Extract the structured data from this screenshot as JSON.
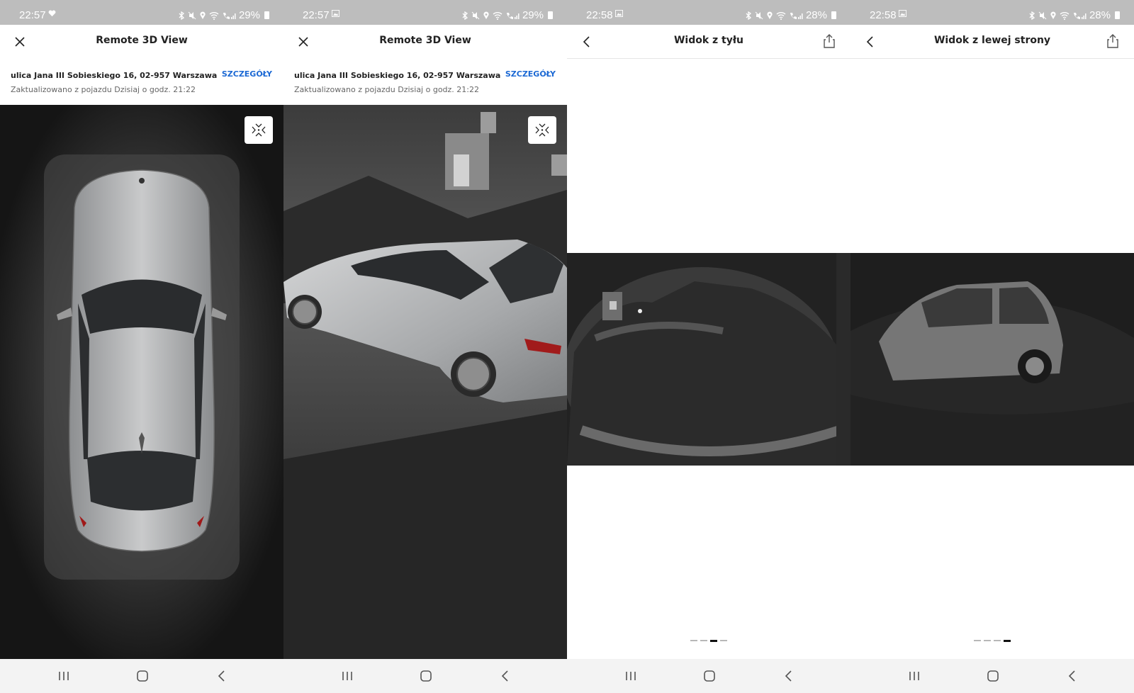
{
  "panels": [
    {
      "status": {
        "time": "22:57",
        "battery": "29%",
        "notif_icon": "heart-icon"
      },
      "header": {
        "title": "Remote 3D View",
        "left_icon": "close-icon"
      },
      "address": {
        "line1": "ulica Jana III Sobieskiego 16, 02-957 Warszawa",
        "line2": "Zaktualizowano z pojazdu Dzisiaj o godz. 21:22",
        "details": "SZCZEGÓŁY"
      }
    },
    {
      "status": {
        "time": "22:57",
        "battery": "29%",
        "notif_icon": "image-icon"
      },
      "header": {
        "title": "Remote 3D View",
        "left_icon": "close-icon"
      },
      "address": {
        "line1": "ulica Jana III Sobieskiego 16, 02-957 Warszawa",
        "line2": "Zaktualizowano z pojazdu Dzisiaj o godz. 21:22",
        "details": "SZCZEGÓŁY"
      }
    },
    {
      "status": {
        "time": "22:58",
        "battery": "28%",
        "notif_icon": "image-icon"
      },
      "header": {
        "title": "Widok z tyłu",
        "left_icon": "back-chevron-icon",
        "right_icon": "share-icon"
      },
      "pager": {
        "total": 4,
        "active_index": 2
      }
    },
    {
      "status": {
        "time": "22:58",
        "battery": "28%",
        "notif_icon": "image-icon"
      },
      "header": {
        "title": "Widok z lewej strony",
        "left_icon": "back-chevron-icon",
        "right_icon": "share-icon"
      },
      "pager": {
        "total": 4,
        "active_index": 3
      }
    }
  ],
  "status_icons": [
    "bluetooth-icon",
    "mute-icon",
    "location-icon",
    "wifi-icon",
    "volte-icon",
    "signal-icon",
    "battery-icon"
  ],
  "navbar_icons": [
    "recent-apps-icon",
    "home-icon",
    "back-icon"
  ],
  "colors": {
    "status_bar": "#bdbdbd",
    "accent": "#1c69d4",
    "nav_bar": "#f3f3f3"
  }
}
